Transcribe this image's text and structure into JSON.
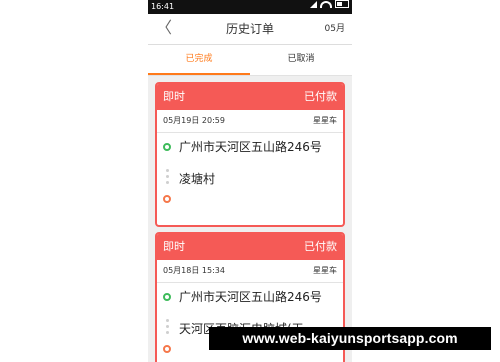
{
  "status_bar": {
    "time": "16:41"
  },
  "header": {
    "back_glyph": "〈",
    "title": "历史订单",
    "month": "05月"
  },
  "tabs": [
    {
      "label": "已完成",
      "active": true
    },
    {
      "label": "已取消",
      "active": false
    }
  ],
  "orders": [
    {
      "kind": "即时",
      "status": "已付款",
      "datetime": "05月19日 20:59",
      "car": "星星车",
      "from": "广州市天河区五山路246号",
      "to": "凌塘村"
    },
    {
      "kind": "即时",
      "status": "已付款",
      "datetime": "05月18日 15:34",
      "car": "星星车",
      "from": "广州市天河区五山路246号",
      "to": "天河区百脑汇电脑城(天"
    }
  ],
  "watermark": "www.web-kaiyunsportsapp.com",
  "colors": {
    "accent": "#ff7a1a",
    "card_red": "#f55a56",
    "pin_start": "#3dbb5a",
    "pin_end": "#f5774a"
  }
}
